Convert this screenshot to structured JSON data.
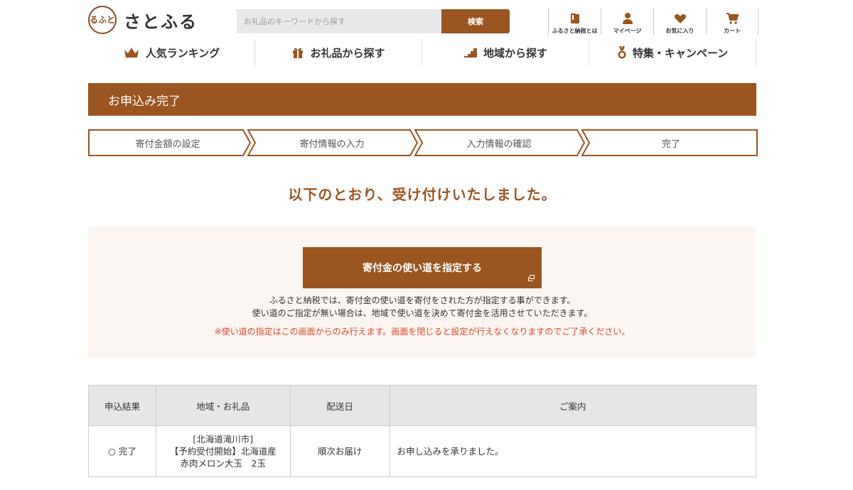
{
  "header": {
    "logo_seal": "るふと",
    "logo_text": "さとふる",
    "search_placeholder": "お礼品のキーワードから探す",
    "search_button": "検索",
    "utility": [
      {
        "label": "ふるさと納税とは",
        "icon": "book-icon"
      },
      {
        "label": "マイページ",
        "icon": "user-icon"
      },
      {
        "label": "お気に入り",
        "icon": "heart-icon"
      },
      {
        "label": "カート",
        "icon": "cart-icon"
      }
    ]
  },
  "gnav": [
    {
      "label": "人気ランキング",
      "icon": "crown-icon"
    },
    {
      "label": "お礼品から探す",
      "icon": "gift-icon"
    },
    {
      "label": "地域から探す",
      "icon": "stairs-icon"
    },
    {
      "label": "特集・キャンペーン",
      "icon": "medal-icon"
    }
  ],
  "page_title": "お申込み完了",
  "steps": [
    "寄付金額の設定",
    "寄付情報の入力",
    "入力情報の確認",
    "完了"
  ],
  "complete_message": "以下のとおり、受け付けいたしました。",
  "usage_panel": {
    "button": "寄付金の使い道を指定する",
    "text_line1": "ふるさと納税では、寄付金の使い道を寄付をされた方が指定する事ができます。",
    "text_line2": "使い道のご指定が無い場合は、地域で使い道を決めて寄付金を活用させていただきます。",
    "note": "※使い道の指定はこの画面からのみ行えます。画面を閉じると設定が行えなくなりますのでご了承ください。"
  },
  "table": {
    "headers": [
      "申込結果",
      "地域・お礼品",
      "配送日",
      "ご案内"
    ],
    "row": {
      "result": "○ 完了",
      "item_line1": "[北海道滝川市]",
      "item_line2": "【予約受付開始】北海道産",
      "item_line3": "赤肉メロン大玉　2玉",
      "delivery": "順次お届け",
      "info": "お申し込みを承りました。"
    }
  },
  "colors": {
    "brand": "#9b5520",
    "panel_bg": "#fbf6f1",
    "note_red": "#d9472b"
  }
}
